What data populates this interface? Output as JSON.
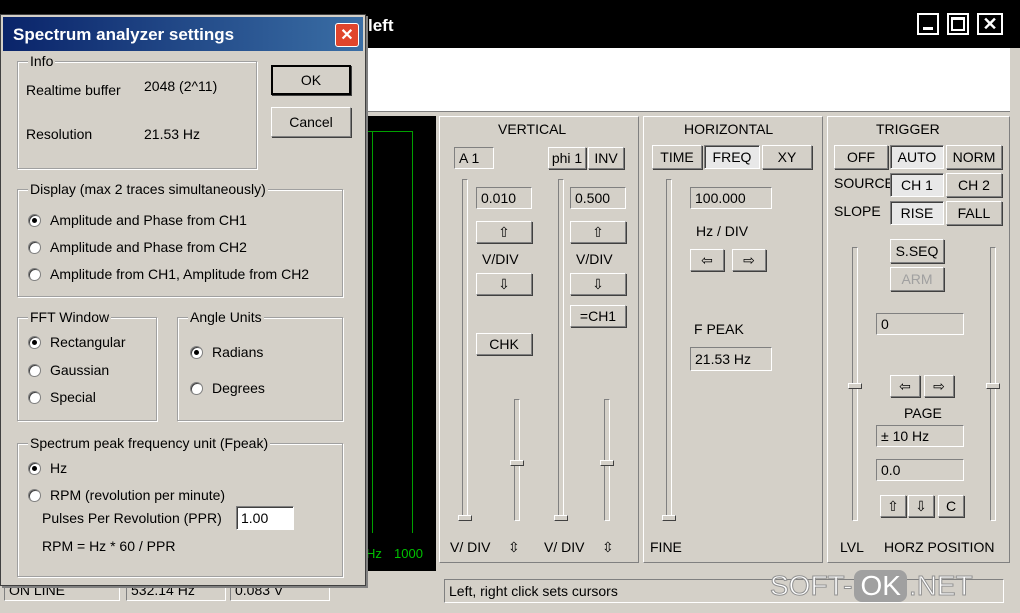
{
  "main_window": {
    "title_fragment": "left",
    "status": {
      "state": "ON LINE",
      "freq": "532.14 Hz",
      "volt": "0.083 V",
      "hint": "Left, right click sets cursors"
    },
    "axis_labels": {
      "hz": "Hz",
      "max": "1000"
    }
  },
  "vertical": {
    "title": "VERTICAL",
    "ch_label": "A 1",
    "phi_button": "phi 1",
    "inv_button": "INV",
    "left_value": "0.010",
    "right_value": "0.500",
    "vdiv_left": "V/DIV",
    "vdiv_right": "V/DIV",
    "chk_button": "CHK",
    "ch1_button": "=CH1",
    "bottom_left": "V/ DIV",
    "bottom_right": "V/ DIV"
  },
  "horizontal": {
    "title": "HORIZONTAL",
    "tabs": [
      "TIME",
      "FREQ",
      "XY"
    ],
    "value": "100.000",
    "unit": "Hz / DIV",
    "peak_label": "F PEAK",
    "peak_value": "21.53 Hz",
    "fine_label": "FINE"
  },
  "trigger": {
    "title": "TRIGGER",
    "modes": [
      "OFF",
      "AUTO",
      "NORM"
    ],
    "source_label": "SOURCE",
    "sources": [
      "CH 1",
      "CH 2"
    ],
    "slope_label": "SLOPE",
    "slopes": [
      "RISE",
      "FALL"
    ],
    "sseq_button": "S.SEQ",
    "arm_button": "ARM",
    "level_value": "0",
    "page_label": "PAGE",
    "page_value": "± 10 Hz",
    "pos_value": "0.0",
    "c_button": "C",
    "lvl_label": "LVL",
    "horz_label": "HORZ POSITION"
  },
  "dialog": {
    "title": "Spectrum analyzer settings",
    "ok": "OK",
    "cancel": "Cancel",
    "info": {
      "label": "Info",
      "buffer_label": "Realtime buffer",
      "buffer_value": "2048  (2^11)",
      "resolution_label": "Resolution",
      "resolution_value": "21.53 Hz"
    },
    "display": {
      "label": "Display (max 2 traces simultaneously)",
      "options": [
        "Amplitude and Phase from CH1",
        "Amplitude and Phase from CH2",
        "Amplitude from CH1, Amplitude from CH2"
      ],
      "selected": 0
    },
    "fft": {
      "label": "FFT Window",
      "options": [
        "Rectangular",
        "Gaussian",
        "Special"
      ],
      "selected": 0
    },
    "angle": {
      "label": "Angle Units",
      "options": [
        "Radians",
        "Degrees"
      ],
      "selected": 0
    },
    "peak": {
      "label": "Spectrum peak frequency unit   (Fpeak)",
      "options": [
        "Hz",
        "RPM (revolution per minute)"
      ],
      "selected": 0,
      "ppr_label": "Pulses Per Revolution (PPR)",
      "ppr_value": "1.00",
      "formula": "RPM = Hz * 60 / PPR"
    }
  },
  "watermark": {
    "left": "SOFT-",
    "mid": "OK",
    "right": ".NET"
  },
  "colors": {
    "face": "#d4d0c8",
    "scope_bg": "#000000",
    "grid": "#00a000",
    "close": "#e0452c"
  }
}
